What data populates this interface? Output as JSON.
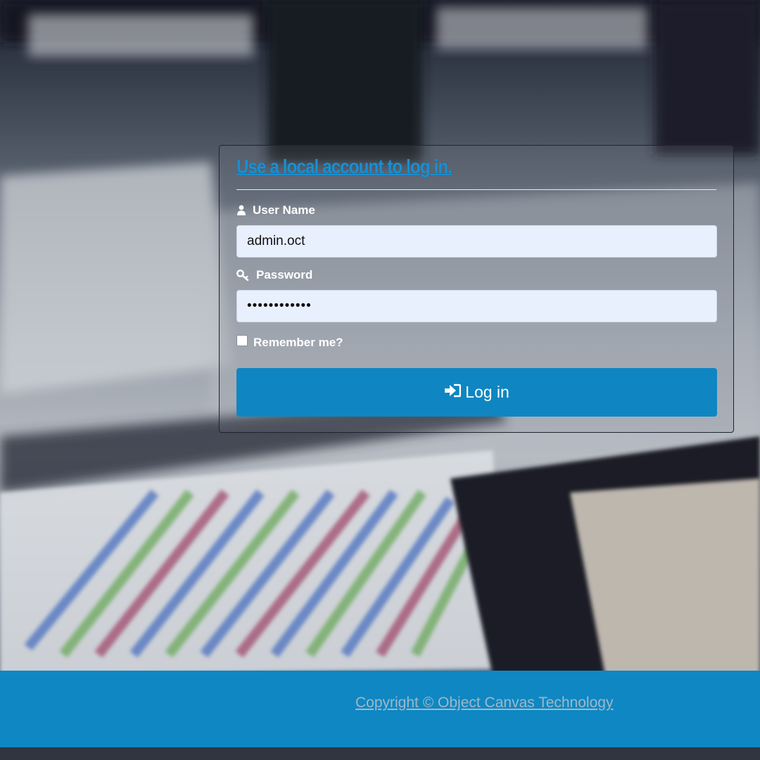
{
  "login_form": {
    "title": "Use a local account to log in.",
    "username_label": "User Name",
    "username_value": "admin.oct",
    "password_label": "Password",
    "password_value": "••••••••••••",
    "remember_label": "Remember me?",
    "remember_checked": false,
    "login_button_label": "Log in",
    "icons": {
      "username": "user-icon",
      "password": "key-icon",
      "login": "sign-in-icon"
    }
  },
  "footer": {
    "copyright_text": "Copyright © Object Canvas Technology"
  },
  "colors": {
    "accent": "#0f86c1",
    "title": "#1a8fd0",
    "input_background": "#e8f0fe",
    "footer_link": "#9fb8c8"
  }
}
